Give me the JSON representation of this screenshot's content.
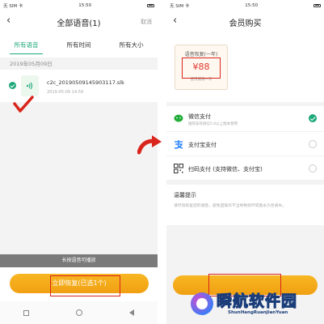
{
  "statusbar": {
    "carrier": "无 SIM 卡",
    "time": "15:50"
  },
  "left": {
    "title": "全部语音(1)",
    "cancel_label": "取消",
    "tabs": [
      {
        "label": "所有语音",
        "active": true
      },
      {
        "label": "所有时间",
        "active": false
      },
      {
        "label": "所有大小",
        "active": false
      }
    ],
    "date_header": "2019年05月09日",
    "file": {
      "name": "c2c_20190509145903117.slk",
      "time": "2019-05-09 14:59"
    },
    "hint": "长按语音可播放",
    "restore_button": "立即恢复(已选1个)"
  },
  "right": {
    "title": "会员购买",
    "vip_card": {
      "title": "语音恢复(一年)",
      "price": "¥88",
      "duration": "使用期限一年"
    },
    "payments": [
      {
        "label": "微信支付",
        "sub": "推荐安装微信5.0以上版本使用",
        "icon": "wechat-pay-icon",
        "selected": true
      },
      {
        "label": "支付宝支付",
        "sub": "",
        "icon": "alipay-icon",
        "selected": false
      },
      {
        "label": "扫码支付 (支持微信、支付宝)",
        "sub": "",
        "icon": "qr-code-icon",
        "selected": false
      }
    ],
    "tips": {
      "title": "温馨提示",
      "body": "请尽快恢复您的语音，避免因操作不当导致损坏或者永久性丢失。"
    }
  },
  "watermark": {
    "main": "瞬航软件园",
    "sub": "ShunHangRuanJianYuan"
  },
  "colors": {
    "accent_green": "#1fa97a",
    "button_orange": "#f5ab1a",
    "annotation_red": "#d9251c"
  }
}
